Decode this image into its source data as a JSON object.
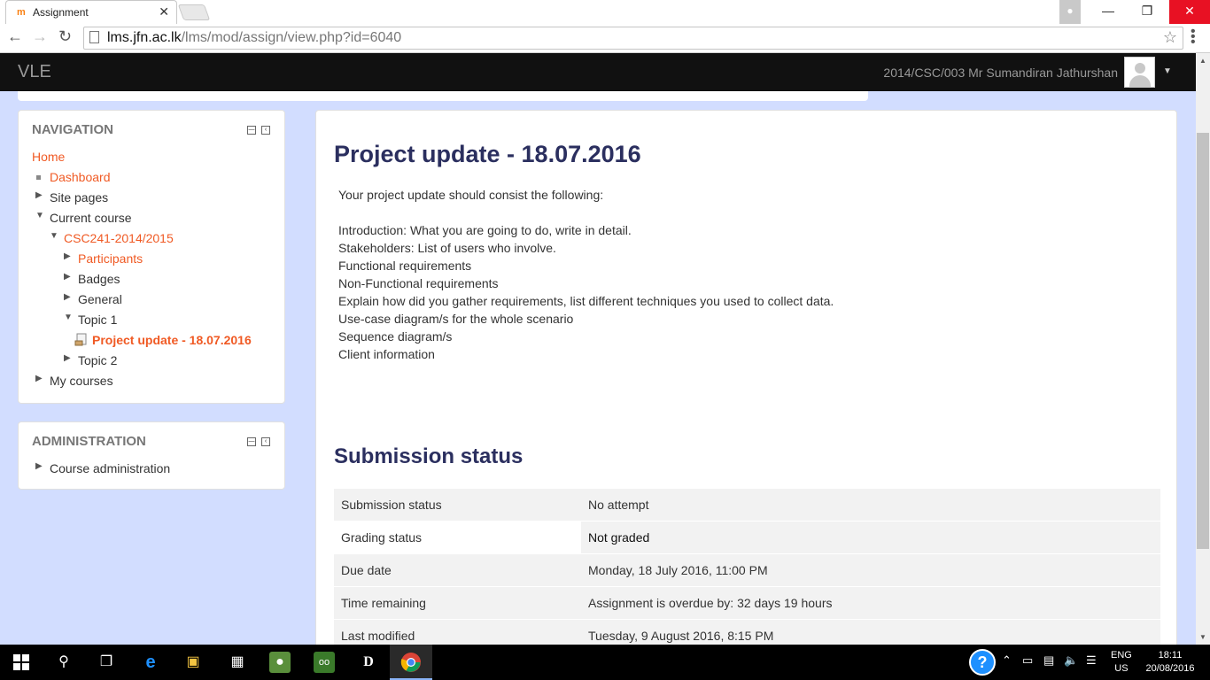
{
  "browser": {
    "tab_title": "Assignment",
    "tab_close": "✕",
    "url_host": "lms.jfn.ac.lk",
    "url_path": "/lms/mod/assign/view.php?id=6040"
  },
  "header": {
    "brand": "VLE",
    "user_name": "2014/CSC/003 Mr Sumandiran Jathurshan"
  },
  "navigation": {
    "title": "NAVIGATION",
    "home": "Home",
    "dashboard": "Dashboard",
    "site_pages": "Site pages",
    "current_course": "Current course",
    "course": "CSC241-2014/2015",
    "participants": "Participants",
    "badges": "Badges",
    "general": "General",
    "topic1": "Topic 1",
    "assignment": "Project update - 18.07.2016",
    "topic2": "Topic 2",
    "my_courses": "My courses"
  },
  "administration": {
    "title": "ADMINISTRATION",
    "course_admin": "Course administration"
  },
  "main": {
    "title": "Project update - 18.07.2016",
    "intro": "Your project update should consist the following:",
    "items": [
      "Introduction: What you are going to do, write in detail.",
      "Stakeholders: List of users who involve.",
      "Functional requirements",
      "Non-Functional requirements",
      "Explain how did you gather requirements, list different techniques you used to collect data.",
      "Use-case diagram/s for the whole scenario",
      "Sequence diagram/s",
      "Client information"
    ],
    "submission_title": "Submission status",
    "rows": [
      {
        "label": "Submission status",
        "value": "No attempt"
      },
      {
        "label": "Grading status",
        "value": "Not graded"
      },
      {
        "label": "Due date",
        "value": "Monday, 18 July 2016, 11:00 PM"
      },
      {
        "label": "Time remaining",
        "value": "Assignment is overdue by: 32 days 19 hours"
      },
      {
        "label": "Last modified",
        "value": "Tuesday, 9 August 2016, 8:15 PM"
      }
    ]
  },
  "taskbar": {
    "lang_line1": "ENG",
    "lang_line2": "US",
    "time": "18:11",
    "date": "20/08/2016"
  }
}
